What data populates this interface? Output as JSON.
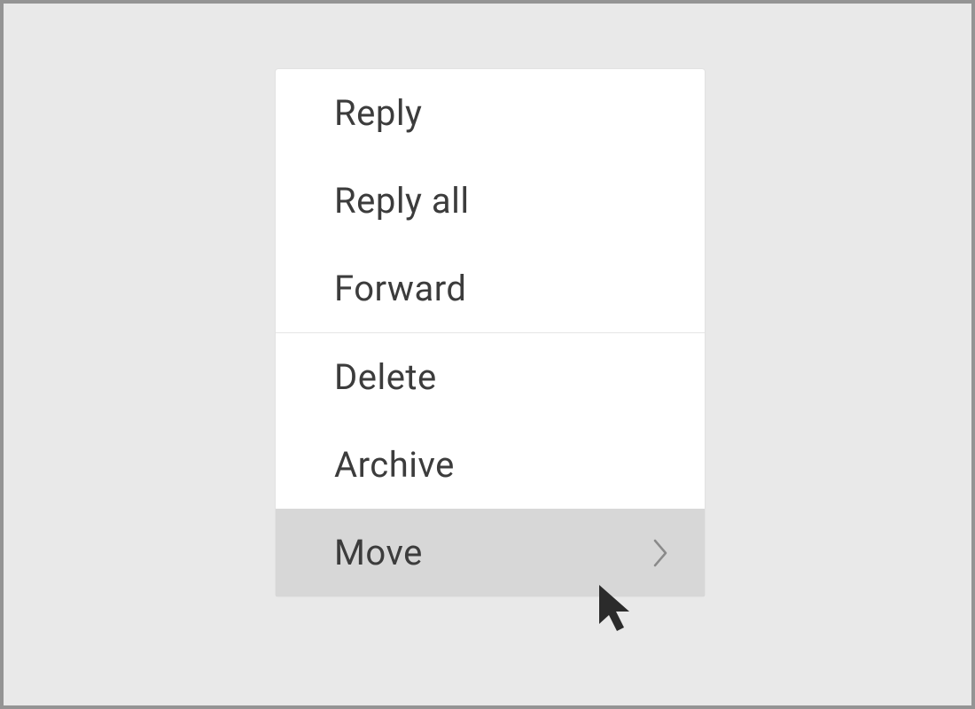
{
  "menu": {
    "groups": [
      {
        "items": [
          {
            "id": "reply",
            "label": "Reply",
            "submenu": false,
            "hovered": false
          },
          {
            "id": "reply-all",
            "label": "Reply all",
            "submenu": false,
            "hovered": false
          },
          {
            "id": "forward",
            "label": "Forward",
            "submenu": false,
            "hovered": false
          }
        ]
      },
      {
        "items": [
          {
            "id": "delete",
            "label": "Delete",
            "submenu": false,
            "hovered": false
          },
          {
            "id": "archive",
            "label": "Archive",
            "submenu": false,
            "hovered": false
          },
          {
            "id": "move",
            "label": "Move",
            "submenu": true,
            "hovered": true
          }
        ]
      }
    ]
  }
}
